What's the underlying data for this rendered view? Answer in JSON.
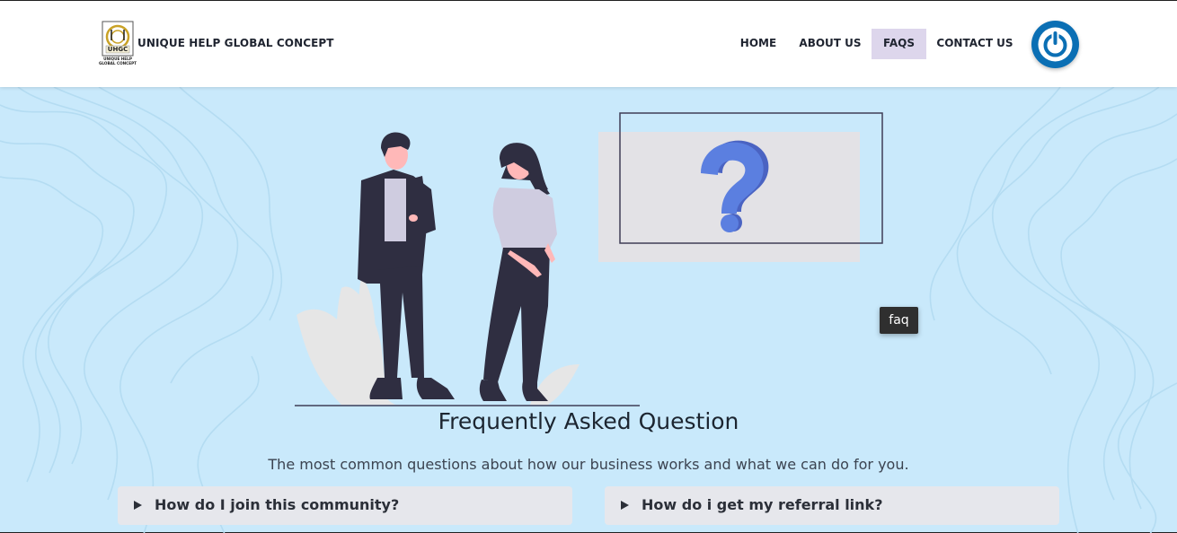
{
  "brand": {
    "name": "UNIQUE HELP GLOBAL CONCEPT",
    "logo_monogram": "UHGC",
    "logo_caption": "UNIQUE HELP GLOBAL CONCEPT"
  },
  "nav": {
    "items": [
      {
        "label": "HOME"
      },
      {
        "label": "ABOUT US"
      },
      {
        "label": "FAQS",
        "active": true
      },
      {
        "label": "CONTACT US"
      }
    ]
  },
  "hero": {
    "tooltip": "faq",
    "title": "Frequently Asked Question",
    "subtitle": "The most common questions about how our business works and what we can do for you."
  },
  "faqs": [
    {
      "question": "How do I join this community?"
    },
    {
      "question": "How do i get my referral link?"
    }
  ],
  "icons": {
    "power": "power-icon",
    "expand": "triangle-right-icon",
    "question": "question-mark-icon"
  },
  "colors": {
    "page_bg": "#c9e9fb",
    "nav_active": "#ddd6ec",
    "power_button": "#0b6fb4",
    "question_mark": "#5b7fe0",
    "faq_card": "#e6e7ec"
  }
}
